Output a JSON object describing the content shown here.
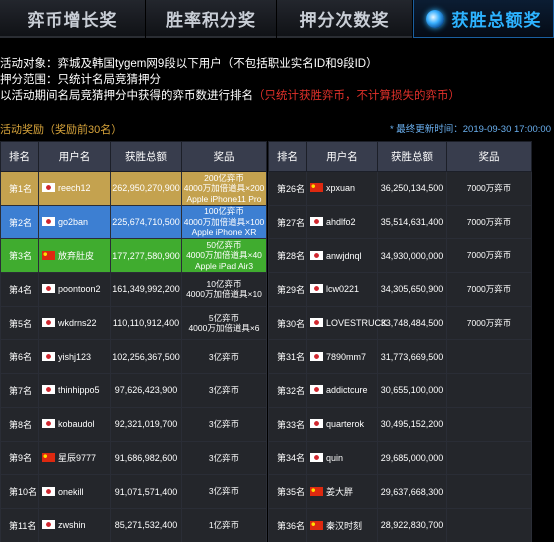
{
  "tabs": [
    {
      "label": "弈币增长奖"
    },
    {
      "label": "胜率积分奖"
    },
    {
      "label": "押分次数奖"
    },
    {
      "label": "获胜总额奖"
    }
  ],
  "info": {
    "line1": "活动对象：弈城及韩国tygem网9段以下用户（不包括职业实名ID和9段ID）",
    "line2": "押分范围：只统计名局竞猜押分",
    "line3": "以活动期间名局竞猜押分中获得的弈币数进行排名",
    "line3_note": "（只统计获胜弈币，不计算损失的弈币）"
  },
  "reward_title": "活动奖励（奖励前30名）",
  "update_time": "* 最终更新时间：2019-09-30 17:00:00",
  "colors": {
    "gold": "#c4a24f",
    "blue": "#3d7fd2",
    "green": "#40ac2f",
    "active_tab": "#2db3ff",
    "red_note": "#e0302a"
  },
  "headers": {
    "rank": "排名",
    "user": "用户名",
    "total": "获胜总额",
    "prize": "奖品"
  },
  "left_rows": [
    {
      "rank": "第1名",
      "flag": "korea-flag",
      "user": "reech12",
      "total": "262,950,270,900",
      "prize": [
        "200亿弈币",
        "4000万加倍道具×200",
        "Apple iPhone11 Pro"
      ],
      "style": "gold"
    },
    {
      "rank": "第2名",
      "flag": "korea-flag",
      "user": "go2ban",
      "total": "225,674,710,500",
      "prize": [
        "100亿弈币",
        "4000万加倍道具×100",
        "Apple iPhone XR"
      ],
      "style": "blue"
    },
    {
      "rank": "第3名",
      "flag": "china-flag",
      "user": "放弃肚皮",
      "total": "177,277,580,900",
      "prize": [
        "50亿弈币",
        "4000万加倍道具×40",
        "Apple iPad Air3"
      ],
      "style": "green"
    },
    {
      "rank": "第4名",
      "flag": "korea-flag",
      "user": "poontoon2",
      "total": "161,349,992,200",
      "prize": [
        "10亿弈币",
        "4000万加倍道具×10"
      ],
      "style": ""
    },
    {
      "rank": "第5名",
      "flag": "korea-flag",
      "user": "wkdrns22",
      "total": "110,110,912,400",
      "prize": [
        "5亿弈币",
        "4000万加倍道具×6"
      ],
      "style": ""
    },
    {
      "rank": "第6名",
      "flag": "korea-flag",
      "user": "yishj123",
      "total": "102,256,367,500",
      "prize": [
        "3亿弈币"
      ],
      "style": ""
    },
    {
      "rank": "第7名",
      "flag": "korea-flag",
      "user": "thinhippo5",
      "total": "97,626,423,900",
      "prize": [
        "3亿弈币"
      ],
      "style": ""
    },
    {
      "rank": "第8名",
      "flag": "korea-flag",
      "user": "kobaudol",
      "total": "92,321,019,700",
      "prize": [
        "3亿弈币"
      ],
      "style": ""
    },
    {
      "rank": "第9名",
      "flag": "china-flag",
      "user": "星辰9777",
      "total": "91,686,982,600",
      "prize": [
        "3亿弈币"
      ],
      "style": ""
    },
    {
      "rank": "第10名",
      "flag": "korea-flag",
      "user": "onekill",
      "total": "91,071,571,400",
      "prize": [
        "3亿弈币"
      ],
      "style": ""
    },
    {
      "rank": "第11名",
      "flag": "korea-flag",
      "user": "zwshin",
      "total": "85,271,532,400",
      "prize": [
        "1亿弈币"
      ],
      "style": ""
    }
  ],
  "right_rows": [
    {
      "rank": "第26名",
      "flag": "china-flag",
      "user": "xpxuan",
      "total": "36,250,134,500",
      "prize": "7000万弈币"
    },
    {
      "rank": "第27名",
      "flag": "korea-flag",
      "user": "ahdlfo2",
      "total": "35,514,631,400",
      "prize": "7000万弈币"
    },
    {
      "rank": "第28名",
      "flag": "korea-flag",
      "user": "anwjdnql",
      "total": "34,930,000,000",
      "prize": "7000万弈币"
    },
    {
      "rank": "第29名",
      "flag": "korea-flag",
      "user": "lcw0221",
      "total": "34,305,650,900",
      "prize": "7000万弈币"
    },
    {
      "rank": "第30名",
      "flag": "korea-flag",
      "user": "LOVESTRUCK",
      "total": "33,748,484,500",
      "prize": "7000万弈币"
    },
    {
      "rank": "第31名",
      "flag": "korea-flag",
      "user": "7890mm7",
      "total": "31,773,669,500",
      "prize": ""
    },
    {
      "rank": "第32名",
      "flag": "korea-flag",
      "user": "addictcure",
      "total": "30,655,100,000",
      "prize": ""
    },
    {
      "rank": "第33名",
      "flag": "korea-flag",
      "user": "quarterok",
      "total": "30,495,152,200",
      "prize": ""
    },
    {
      "rank": "第34名",
      "flag": "korea-flag",
      "user": "quin",
      "total": "29,685,000,000",
      "prize": ""
    },
    {
      "rank": "第35名",
      "flag": "china-flag",
      "user": "姜大胖",
      "total": "29,637,668,300",
      "prize": ""
    },
    {
      "rank": "第36名",
      "flag": "china-flag",
      "user": "秦汉时刻",
      "total": "28,922,830,700",
      "prize": ""
    }
  ]
}
